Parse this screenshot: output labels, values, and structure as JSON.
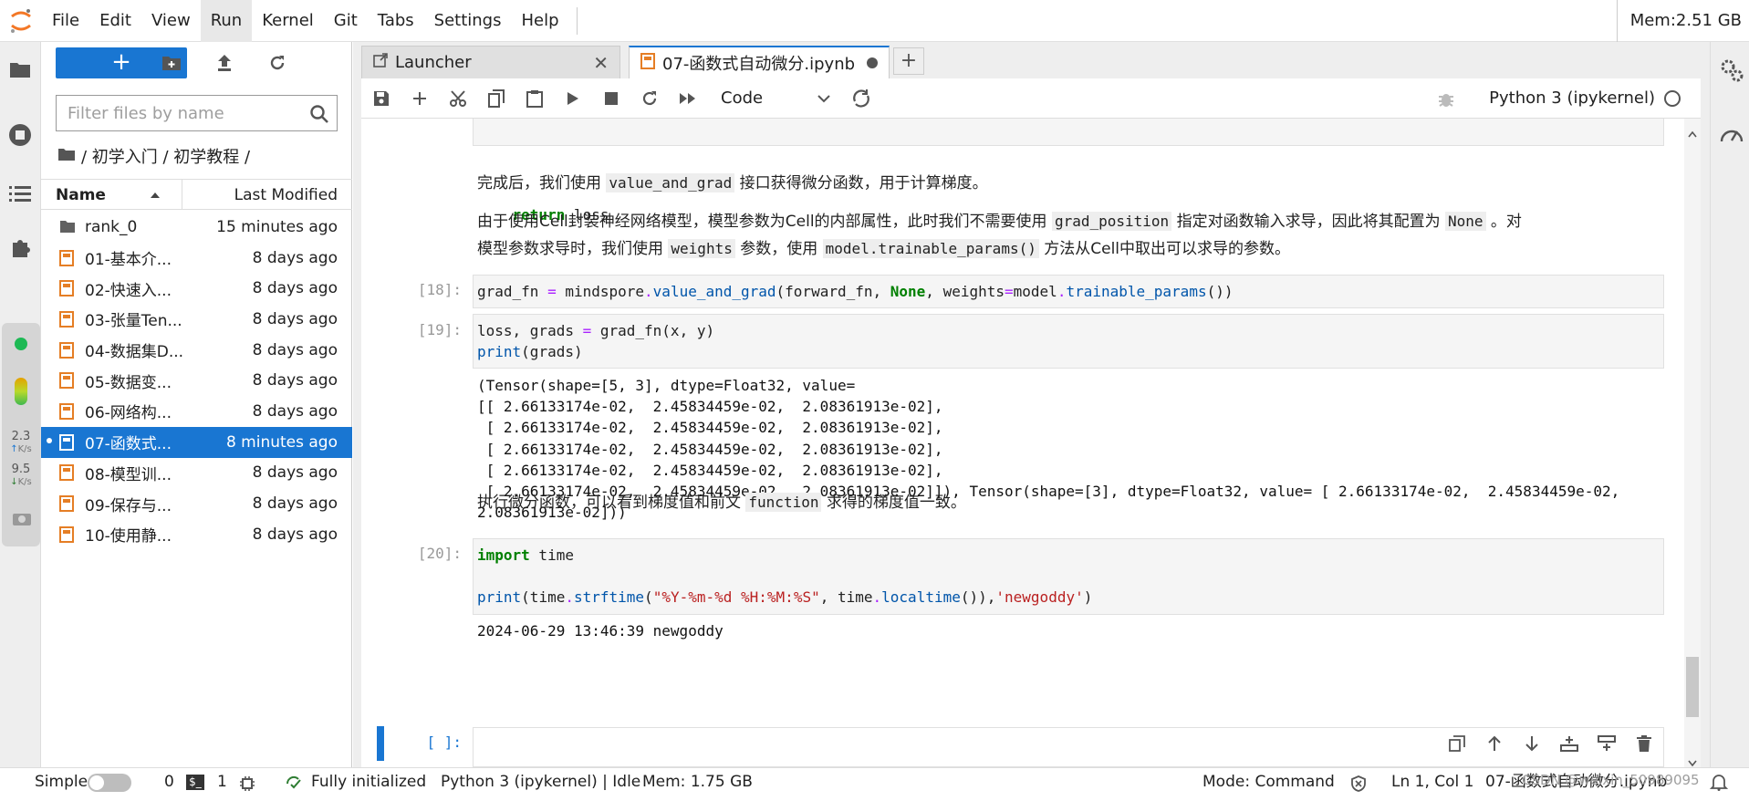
{
  "menu": {
    "items": [
      "File",
      "Edit",
      "View",
      "Run",
      "Kernel",
      "Git",
      "Tabs",
      "Settings",
      "Help"
    ],
    "active_index": 3,
    "memory": "Mem:2.51 GB"
  },
  "monitor": {
    "upload_value": "2.3",
    "upload_unit": "K/s",
    "download_value": "9.5",
    "download_unit": "K/s"
  },
  "file_browser": {
    "new_button_label": "+",
    "search_placeholder": "Filter files by name",
    "breadcrumb": "/ 初学入门 / 初学教程 /",
    "col_name": "Name",
    "col_modified": "Last Modified",
    "files": [
      {
        "name": "rank_0",
        "modified": "15 minutes ago",
        "type": "folder"
      },
      {
        "name": "01-基本介...",
        "modified": "8 days ago",
        "type": "notebook"
      },
      {
        "name": "02-快速入...",
        "modified": "8 days ago",
        "type": "notebook"
      },
      {
        "name": "03-张量Ten...",
        "modified": "8 days ago",
        "type": "notebook"
      },
      {
        "name": "04-数据集D...",
        "modified": "8 days ago",
        "type": "notebook"
      },
      {
        "name": "05-数据变...",
        "modified": "8 days ago",
        "type": "notebook"
      },
      {
        "name": "06-网络构...",
        "modified": "8 days ago",
        "type": "notebook"
      },
      {
        "name": "07-函数式...",
        "modified": "8 minutes ago",
        "type": "notebook",
        "selected": true
      },
      {
        "name": "08-模型训...",
        "modified": "8 days ago",
        "type": "notebook"
      },
      {
        "name": "09-保存与...",
        "modified": "8 days ago",
        "type": "notebook"
      },
      {
        "name": "10-使用静...",
        "modified": "8 days ago",
        "type": "notebook"
      }
    ]
  },
  "tabs": {
    "launcher": "Launcher",
    "notebook": "07-函数式自动微分.ipynb",
    "add": "+"
  },
  "toolbar": {
    "cell_type": "Code",
    "kernel": "Python 3 (ipykernel)"
  },
  "cells": {
    "partial_code_line": "    return loss",
    "md1_text": "完成后，我们使用 value_and_grad 接口获得微分函数，用于计算梯度。",
    "md2_line1": "由于使用Cell封装神经网络模型，模型参数为Cell的内部属性，此时我们不需要使用 grad_position 指定对函数输入求导，因此将其配置为 None 。对",
    "md2_line2": "模型参数求导时，我们使用 weights 参数，使用 model.trainable_params() 方法从Cell中取出可以求导的参数。",
    "prompt18": "[18]:",
    "code18": "grad_fn = mindspore.value_and_grad(forward_fn, None, weights=model.trainable_params())",
    "prompt19": "[19]:",
    "code19_line1": "loss, grads = grad_fn(x, y)",
    "code19_line2": "print(grads)",
    "output19": "(Tensor(shape=[5, 3], dtype=Float32, value=\n[[ 2.66133174e-02,  2.45834459e-02,  2.08361913e-02],\n [ 2.66133174e-02,  2.45834459e-02,  2.08361913e-02],\n [ 2.66133174e-02,  2.45834459e-02,  2.08361913e-02],\n [ 2.66133174e-02,  2.45834459e-02,  2.08361913e-02],\n [ 2.66133174e-02,  2.45834459e-02,  2.08361913e-02]]), Tensor(shape=[3], dtype=Float32, value= [ 2.66133174e-02,  2.45834459e-02,\n2.08361913e-02]))",
    "md3_text": "执行微分函数，可以看到梯度值和前文 function 求得的梯度值一致。",
    "prompt20": "[20]:",
    "code20_line1": "import time",
    "code20_line3": "print(time.strftime(\"%Y-%m-%d %H:%M:%S\", time.localtime()),'newgoddy')",
    "output20": "2024-06-29 13:46:39 newgoddy",
    "prompt_empty": "[ ]:"
  },
  "status": {
    "mode_label": "Simple",
    "terminals": "0",
    "kernels": "1",
    "init": "Fully initialized",
    "kernel_state": "Python 3 (ipykernel) | Idle",
    "mem": "Mem: 1.75 GB",
    "command_mode": "Mode: Command",
    "position": "Ln 1, Col 1",
    "file": "07-函数式自动微分.ipynb",
    "watermark": "CSDN @weixin_50989095"
  },
  "colors": {
    "accent": "#1976d2",
    "notebook_icon": "#e57e25",
    "kernel_running": "#4caf50"
  }
}
